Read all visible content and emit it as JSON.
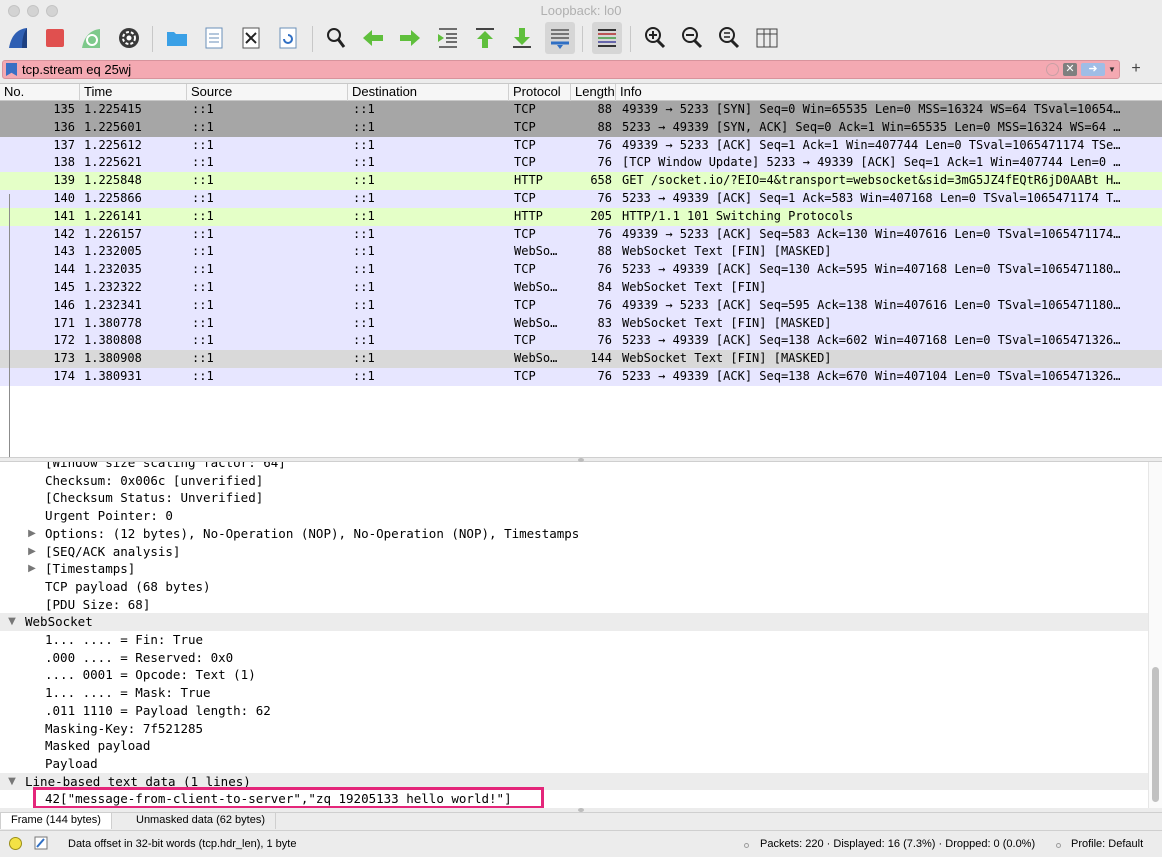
{
  "window": {
    "title": "Loopback: lo0"
  },
  "toolbar": {
    "buttons": [
      "start-capture",
      "stop-capture",
      "restart-capture",
      "capture-options",
      "open-file",
      "save-file",
      "close-file",
      "reload-file",
      "find-packet",
      "go-back",
      "go-forward",
      "go-to-packet",
      "go-first",
      "go-last",
      "auto-scroll",
      "colorize",
      "zoom-in",
      "zoom-out",
      "zoom-normal",
      "resize-columns"
    ]
  },
  "filter": {
    "value": "tcp.stream eq 25wj",
    "bg_color": "#f4a9b2",
    "add_label": "+"
  },
  "columns": [
    "No.",
    "Time",
    "Source",
    "Destination",
    "Protocol",
    "Length",
    "Info"
  ],
  "packets": [
    {
      "no": "135",
      "time": "1.225415",
      "src": "::1",
      "dst": "::1",
      "proto": "TCP",
      "len": "88",
      "info": "49339 → 5233 [SYN] Seq=0 Win=65535 Len=0 MSS=16324 WS=64 TSval=10654…",
      "style": "sel"
    },
    {
      "no": "136",
      "time": "1.225601",
      "src": "::1",
      "dst": "::1",
      "proto": "TCP",
      "len": "88",
      "info": "5233 → 49339 [SYN, ACK] Seq=0 Ack=1 Win=65535 Len=0 MSS=16324 WS=64 …",
      "style": "sel"
    },
    {
      "no": "137",
      "time": "1.225612",
      "src": "::1",
      "dst": "::1",
      "proto": "TCP",
      "len": "76",
      "info": "49339 → 5233 [ACK] Seq=1 Ack=1 Win=407744 Len=0 TSval=1065471174 TSe…",
      "style": "tcp"
    },
    {
      "no": "138",
      "time": "1.225621",
      "src": "::1",
      "dst": "::1",
      "proto": "TCP",
      "len": "76",
      "info": "[TCP Window Update] 5233 → 49339 [ACK] Seq=1 Ack=1 Win=407744 Len=0 …",
      "style": "tcp"
    },
    {
      "no": "139",
      "time": "1.225848",
      "src": "::1",
      "dst": "::1",
      "proto": "HTTP",
      "len": "658",
      "info": "GET /socket.io/?EIO=4&transport=websocket&sid=3mG5JZ4fEQtR6jD0AABt H…",
      "style": "http"
    },
    {
      "no": "140",
      "time": "1.225866",
      "src": "::1",
      "dst": "::1",
      "proto": "TCP",
      "len": "76",
      "info": "5233 → 49339 [ACK] Seq=1 Ack=583 Win=407168 Len=0 TSval=1065471174 T…",
      "style": "tcp"
    },
    {
      "no": "141",
      "time": "1.226141",
      "src": "::1",
      "dst": "::1",
      "proto": "HTTP",
      "len": "205",
      "info": "HTTP/1.1 101 Switching Protocols",
      "style": "http"
    },
    {
      "no": "142",
      "time": "1.226157",
      "src": "::1",
      "dst": "::1",
      "proto": "TCP",
      "len": "76",
      "info": "49339 → 5233 [ACK] Seq=583 Ack=130 Win=407616 Len=0 TSval=1065471174…",
      "style": "tcp"
    },
    {
      "no": "143",
      "time": "1.232005",
      "src": "::1",
      "dst": "::1",
      "proto": "WebSo…",
      "len": "88",
      "info": "WebSocket Text [FIN] [MASKED]",
      "style": "tcp"
    },
    {
      "no": "144",
      "time": "1.232035",
      "src": "::1",
      "dst": "::1",
      "proto": "TCP",
      "len": "76",
      "info": "5233 → 49339 [ACK] Seq=130 Ack=595 Win=407168 Len=0 TSval=1065471180…",
      "style": "tcp"
    },
    {
      "no": "145",
      "time": "1.232322",
      "src": "::1",
      "dst": "::1",
      "proto": "WebSo…",
      "len": "84",
      "info": "WebSocket Text [FIN]",
      "style": "tcp"
    },
    {
      "no": "146",
      "time": "1.232341",
      "src": "::1",
      "dst": "::1",
      "proto": "TCP",
      "len": "76",
      "info": "49339 → 5233 [ACK] Seq=595 Ack=138 Win=407616 Len=0 TSval=1065471180…",
      "style": "tcp"
    },
    {
      "no": "171",
      "time": "1.380778",
      "src": "::1",
      "dst": "::1",
      "proto": "WebSo…",
      "len": "83",
      "info": "WebSocket Text [FIN] [MASKED]",
      "style": "tcp"
    },
    {
      "no": "172",
      "time": "1.380808",
      "src": "::1",
      "dst": "::1",
      "proto": "TCP",
      "len": "76",
      "info": "5233 → 49339 [ACK] Seq=138 Ack=602 Win=407168 Len=0 TSval=1065471326…",
      "style": "tcp"
    },
    {
      "no": "173",
      "time": "1.380908",
      "src": "::1",
      "dst": "::1",
      "proto": "WebSo…",
      "len": "144",
      "info": "WebSocket Text [FIN] [MASKED]",
      "style": "mark"
    },
    {
      "no": "174",
      "time": "1.380931",
      "src": "::1",
      "dst": "::1",
      "proto": "TCP",
      "len": "76",
      "info": "5233 → 49339 [ACK] Seq=138 Ack=670 Win=407104 Len=0 TSval=1065471326…",
      "style": "tcp"
    }
  ],
  "details": [
    {
      "text": "[Window size scaling factor: 64]",
      "indent": 1,
      "arrow": "",
      "section": false
    },
    {
      "text": "Checksum: 0x006c [unverified]",
      "indent": 1,
      "arrow": "",
      "section": false
    },
    {
      "text": "[Checksum Status: Unverified]",
      "indent": 1,
      "arrow": "",
      "section": false
    },
    {
      "text": "Urgent Pointer: 0",
      "indent": 1,
      "arrow": "",
      "section": false
    },
    {
      "text": "Options: (12 bytes), No-Operation (NOP), No-Operation (NOP), Timestamps",
      "indent": 1,
      "arrow": "right",
      "section": false
    },
    {
      "text": "[SEQ/ACK analysis]",
      "indent": 1,
      "arrow": "right",
      "section": false
    },
    {
      "text": "[Timestamps]",
      "indent": 1,
      "arrow": "right",
      "section": false
    },
    {
      "text": "TCP payload (68 bytes)",
      "indent": 1,
      "arrow": "",
      "section": false
    },
    {
      "text": "[PDU Size: 68]",
      "indent": 1,
      "arrow": "",
      "section": false
    },
    {
      "text": "WebSocket",
      "indent": 0,
      "arrow": "down",
      "section": true
    },
    {
      "text": "1... .... = Fin: True",
      "indent": 1,
      "arrow": "",
      "section": false
    },
    {
      "text": ".000 .... = Reserved: 0x0",
      "indent": 1,
      "arrow": "",
      "section": false
    },
    {
      "text": ".... 0001 = Opcode: Text (1)",
      "indent": 1,
      "arrow": "",
      "section": false
    },
    {
      "text": "1... .... = Mask: True",
      "indent": 1,
      "arrow": "",
      "section": false
    },
    {
      "text": ".011 1110 = Payload length: 62",
      "indent": 1,
      "arrow": "",
      "section": false
    },
    {
      "text": "Masking-Key: 7f521285",
      "indent": 1,
      "arrow": "",
      "section": false
    },
    {
      "text": "Masked payload",
      "indent": 1,
      "arrow": "",
      "section": false
    },
    {
      "text": "Payload",
      "indent": 1,
      "arrow": "",
      "section": false
    },
    {
      "text": "Line-based text data (1 lines)",
      "indent": 0,
      "arrow": "down",
      "section": true
    },
    {
      "text": "42[\"message-from-client-to-server\",\"zq 19205133 hello world!\"]",
      "indent": 1,
      "arrow": "",
      "section": false
    }
  ],
  "byte_tabs": [
    "Frame (144 bytes)",
    "Unmasked data (62 bytes)"
  ],
  "status": {
    "field": "Data offset in 32-bit words (tcp.hdr_len), 1 byte",
    "packets": "Packets: 220 · Displayed: 16 (7.3%) · Dropped: 0 (0.0%)",
    "profile": "Profile: Default"
  },
  "colors": {
    "tcp": "#e7e6ff",
    "http": "#e4ffc7",
    "selected": "#a6a6a6",
    "marked": "#d9d9d9",
    "highlight_box": "#e4267a"
  }
}
